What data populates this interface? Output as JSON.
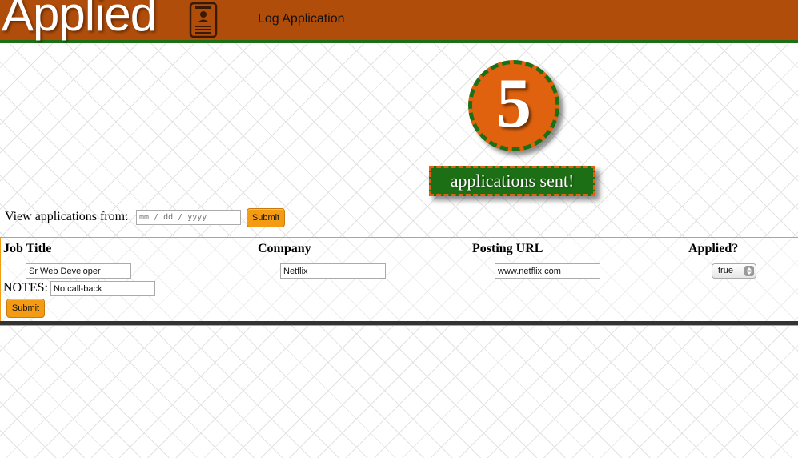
{
  "header": {
    "brand": "Applied",
    "brand_icon": "id-badge-icon",
    "nav_link": "Log Application",
    "colors": {
      "bar": "#b04d0b",
      "rule": "#1d6f15"
    }
  },
  "summary": {
    "count": "5",
    "caption": "applications sent!",
    "colors": {
      "circle": "#e0620e",
      "caption_box": "#1d6f15"
    }
  },
  "filter": {
    "label": "View applications from:",
    "date_placeholder": "mm / dd / yyyy",
    "submit_label": "Submit"
  },
  "entry": {
    "columns": [
      "Job Title",
      "Company",
      "Posting URL",
      "Applied?"
    ],
    "job_title": "Sr Web Developer",
    "company": "Netflix",
    "posting_url": "www.netflix.com",
    "applied": "true",
    "notes_label": "NOTES:",
    "notes": "No call-back",
    "submit_label": "Submit"
  },
  "accent": "#f49b14"
}
